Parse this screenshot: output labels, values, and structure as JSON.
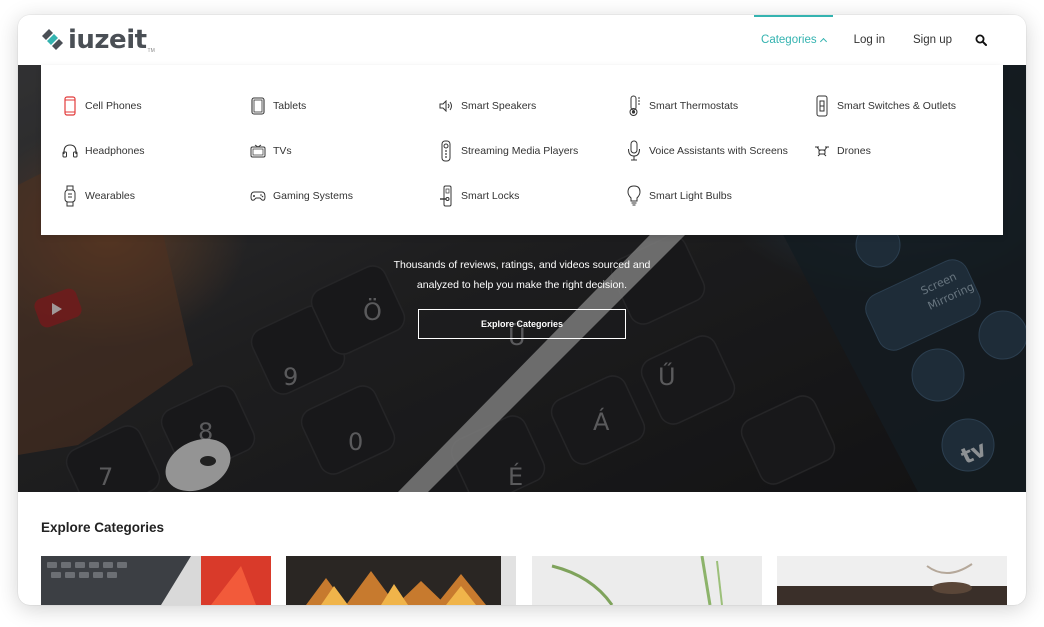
{
  "brand": {
    "logo_text": "iuzeit",
    "trademark": "TM",
    "accent_color": "#34b3b0"
  },
  "nav": {
    "categories_label": "Categories",
    "login_label": "Log in",
    "signup_label": "Sign up",
    "search_icon": "search-icon"
  },
  "dropdown": {
    "items": [
      {
        "label": "Cell Phones",
        "icon": "cell-phone-icon"
      },
      {
        "label": "Tablets",
        "icon": "tablet-icon"
      },
      {
        "label": "Smart Speakers",
        "icon": "speaker-icon"
      },
      {
        "label": "Smart Thermostats",
        "icon": "thermometer-icon"
      },
      {
        "label": "Smart Switches & Outlets",
        "icon": "switch-icon"
      },
      {
        "label": "Headphones",
        "icon": "headphones-icon"
      },
      {
        "label": "TVs",
        "icon": "tv-icon"
      },
      {
        "label": "Streaming Media Players",
        "icon": "remote-icon"
      },
      {
        "label": "Voice Assistants with Screens",
        "icon": "microphone-icon"
      },
      {
        "label": "Drones",
        "icon": "drone-icon"
      },
      {
        "label": "Wearables",
        "icon": "watch-icon"
      },
      {
        "label": "Gaming Systems",
        "icon": "gamepad-icon"
      },
      {
        "label": "Smart Locks",
        "icon": "lock-icon"
      },
      {
        "label": "Smart Light Bulbs",
        "icon": "lightbulb-icon"
      }
    ]
  },
  "hero": {
    "subtitle_line1": "Thousands of reviews, ratings, and videos sourced and",
    "subtitle_line2": "analyzed to help you make the right decision.",
    "button_label": "Explore Categories"
  },
  "explore": {
    "title": "Explore Categories"
  }
}
